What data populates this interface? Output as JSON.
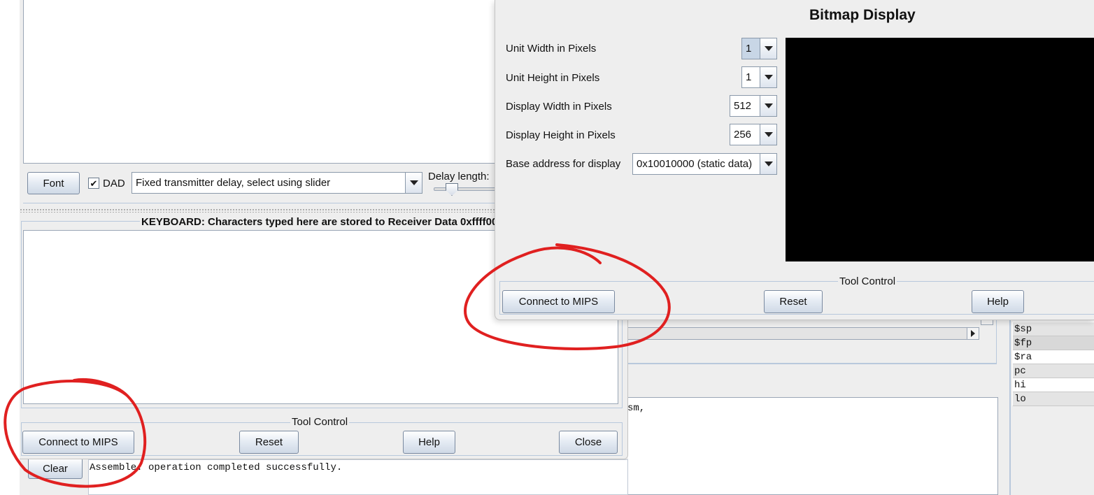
{
  "display_panel": {
    "font_button": "Font",
    "dad_checkbox": {
      "label": "DAD",
      "checked": true,
      "mark": "✔"
    },
    "delay_mode": "Fixed transmitter delay, select using slider",
    "delay_length_label": "Delay length:"
  },
  "keyboard_panel": {
    "title": "KEYBOARD: Characters typed here are stored to Receiver Data 0xffff00"
  },
  "tool_control_left": {
    "title": "Tool Control",
    "connect_button": "Connect to MIPS",
    "reset_button": "Reset",
    "help_button": "Help",
    "close_button": "Close"
  },
  "messages": {
    "clear_button": "Clear",
    "log_line": "Assemble: operation completed successfully.",
    "partial_text": "sm,"
  },
  "registers": [
    {
      "name": "$sp"
    },
    {
      "name": "$fp"
    },
    {
      "name": "$ra"
    },
    {
      "name": "pc"
    },
    {
      "name": "hi"
    },
    {
      "name": "lo"
    }
  ],
  "bitmap_display": {
    "title": "Bitmap Display",
    "settings": [
      {
        "label": "Unit Width in Pixels",
        "value": "1"
      },
      {
        "label": "Unit Height in Pixels",
        "value": "1"
      },
      {
        "label": "Display Width in Pixels",
        "value": "512"
      },
      {
        "label": "Display Height in Pixels",
        "value": "256"
      },
      {
        "label": "Base address for display",
        "value": "0x10010000 (static data)"
      }
    ],
    "tool_control": {
      "title": "Tool Control",
      "connect_button": "Connect to MIPS",
      "reset_button": "Reset",
      "help_button": "Help"
    },
    "canvas_color": "#000000"
  },
  "annotation_color": "#e02020"
}
